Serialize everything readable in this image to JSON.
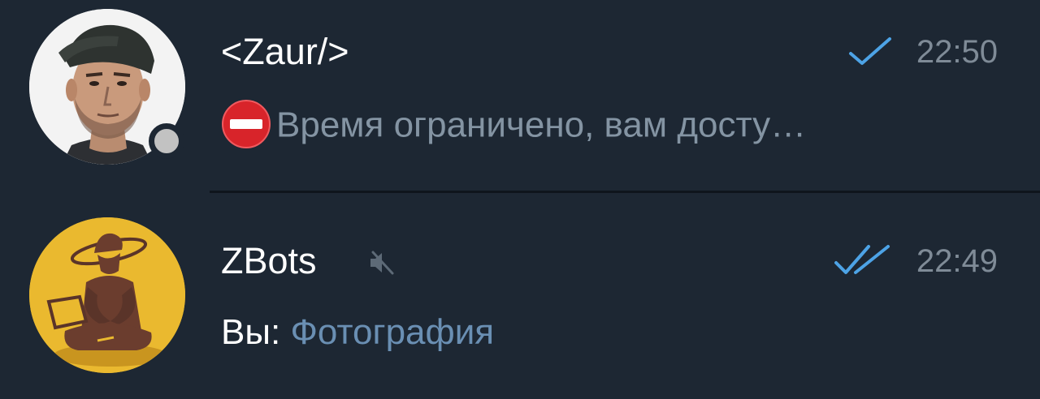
{
  "chats": [
    {
      "title": "<Zaur/>",
      "time": "22:50",
      "status": "sent",
      "preview_icon": "no-entry-icon",
      "preview": "Время ограничено, вам досту…",
      "online_indicator": "offline",
      "muted": false
    },
    {
      "title": "ZBots",
      "time": "22:49",
      "status": "read",
      "muted": true,
      "preview_sender": "Вы:",
      "preview_attachment": "Фотография"
    }
  ],
  "colors": {
    "background": "#1d2733",
    "title": "#ffffff",
    "time": "#7f8b97",
    "preview": "#8494a3",
    "check": "#4da3e6",
    "avatar_bot_bg": "#eab92f"
  }
}
